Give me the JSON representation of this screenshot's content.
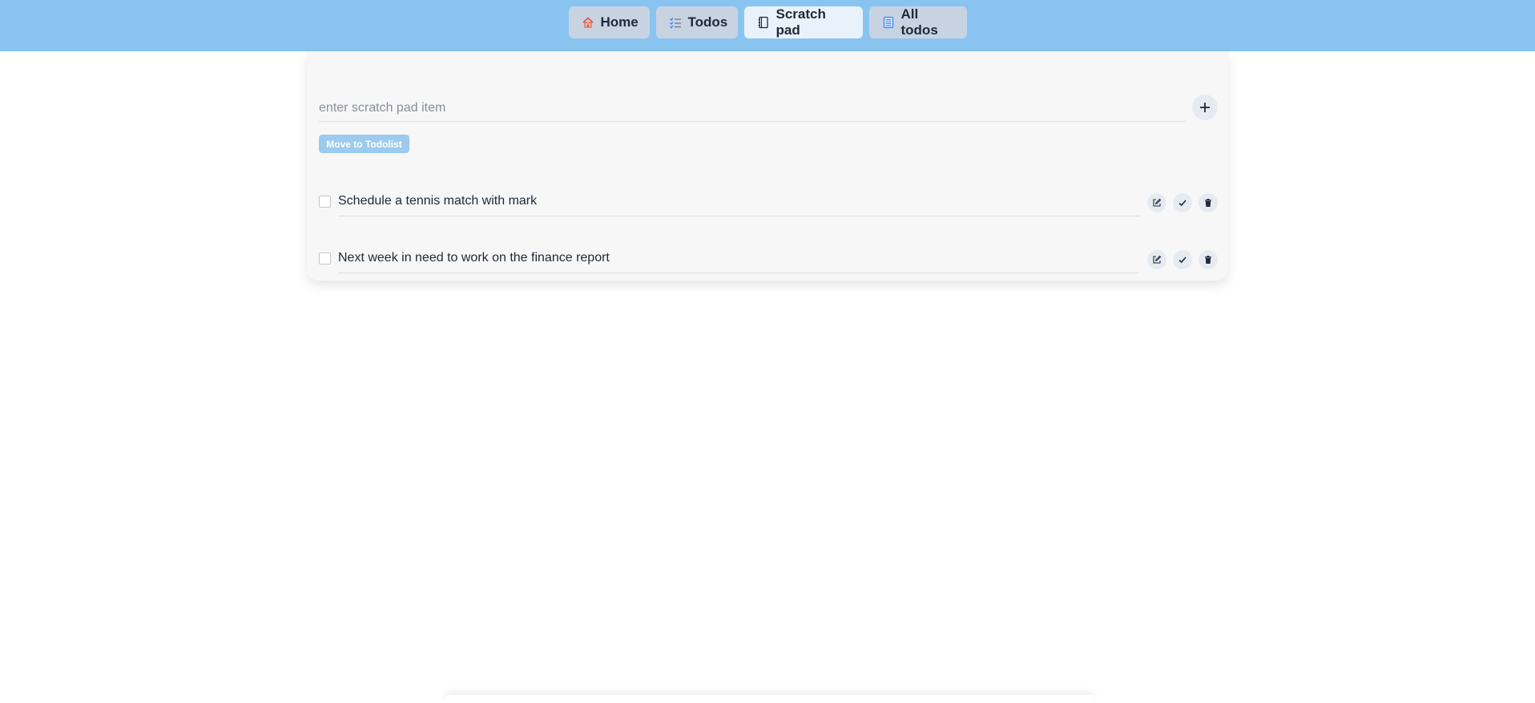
{
  "nav": {
    "items": [
      {
        "label": "Home",
        "icon": "home-icon"
      },
      {
        "label": "Todos",
        "icon": "checklist-icon"
      },
      {
        "label": "Scratch pad",
        "icon": "notebook-icon",
        "active": true
      },
      {
        "label": "All todos",
        "icon": "list-icon"
      }
    ]
  },
  "scratch": {
    "placeholder": "enter scratch pad item",
    "value": "",
    "move_label": "Move to Todolist",
    "items": [
      {
        "text": "Schedule a tennis match with mark",
        "checked": false
      },
      {
        "text": "Next week in need to work on the finance report",
        "checked": false
      }
    ]
  },
  "colors": {
    "topbar": "#89c4f0",
    "nav_button": "#c8d3e2",
    "nav_button_active": "#e9f2fb",
    "move_button": "#9ccbef",
    "card": "#f7f7f7"
  }
}
